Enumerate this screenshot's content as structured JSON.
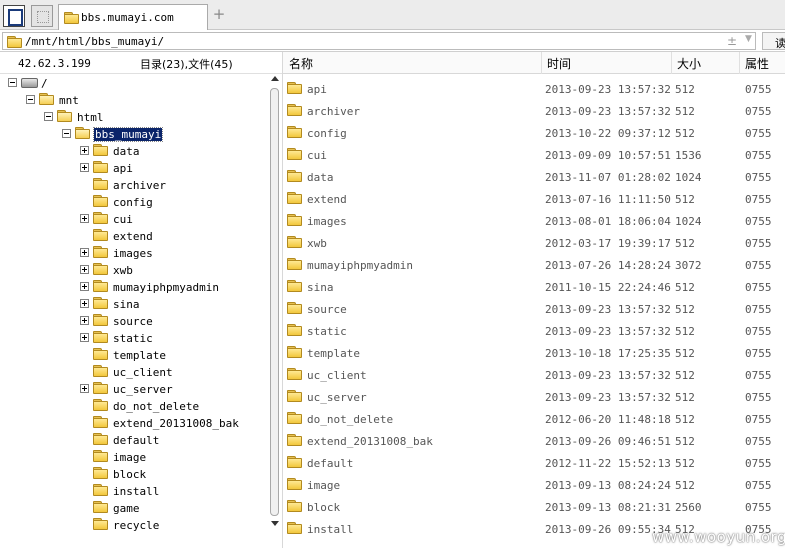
{
  "tabbar": {
    "tab_title": "bbs.mumayi.com",
    "add_label": "+"
  },
  "address": {
    "path": "/mnt/html/bbs_mumayi/",
    "plusminus": "±",
    "dropdown": "▼",
    "read_label": "读"
  },
  "info": {
    "ip": "42.62.3.199",
    "counts": "目录(23),文件(45)"
  },
  "tree": {
    "root": "/",
    "mnt": "mnt",
    "html": "html",
    "current": "bbs_mumayi",
    "children": [
      {
        "name": "data",
        "expandable": true
      },
      {
        "name": "api",
        "expandable": true
      },
      {
        "name": "archiver",
        "expandable": false
      },
      {
        "name": "config",
        "expandable": false
      },
      {
        "name": "cui",
        "expandable": true
      },
      {
        "name": "extend",
        "expandable": false
      },
      {
        "name": "images",
        "expandable": true
      },
      {
        "name": "xwb",
        "expandable": true
      },
      {
        "name": "mumayiphpmyadmin",
        "expandable": true
      },
      {
        "name": "sina",
        "expandable": true
      },
      {
        "name": "source",
        "expandable": true
      },
      {
        "name": "static",
        "expandable": true
      },
      {
        "name": "template",
        "expandable": false
      },
      {
        "name": "uc_client",
        "expandable": false
      },
      {
        "name": "uc_server",
        "expandable": true
      },
      {
        "name": "do_not_delete",
        "expandable": false
      },
      {
        "name": "extend_20131008_bak",
        "expandable": false
      },
      {
        "name": "default",
        "expandable": false
      },
      {
        "name": "image",
        "expandable": false
      },
      {
        "name": "block",
        "expandable": false
      },
      {
        "name": "install",
        "expandable": false
      },
      {
        "name": "game",
        "expandable": false
      },
      {
        "name": "recycle",
        "expandable": false
      }
    ]
  },
  "filelist": {
    "columns": {
      "name": "名称",
      "time": "时间",
      "size": "大小",
      "attr": "属性"
    },
    "rows": [
      {
        "name": "api",
        "time": "2013-09-23 13:57:32",
        "size": "512",
        "attr": "0755"
      },
      {
        "name": "archiver",
        "time": "2013-09-23 13:57:32",
        "size": "512",
        "attr": "0755"
      },
      {
        "name": "config",
        "time": "2013-10-22 09:37:12",
        "size": "512",
        "attr": "0755"
      },
      {
        "name": "cui",
        "time": "2013-09-09 10:57:51",
        "size": "1536",
        "attr": "0755"
      },
      {
        "name": "data",
        "time": "2013-11-07 01:28:02",
        "size": "1024",
        "attr": "0755"
      },
      {
        "name": "extend",
        "time": "2013-07-16 11:11:50",
        "size": "512",
        "attr": "0755"
      },
      {
        "name": "images",
        "time": "2013-08-01 18:06:04",
        "size": "1024",
        "attr": "0755"
      },
      {
        "name": "xwb",
        "time": "2012-03-17 19:39:17",
        "size": "512",
        "attr": "0755"
      },
      {
        "name": "mumayiphpmyadmin",
        "time": "2013-07-26 14:28:24",
        "size": "3072",
        "attr": "0755"
      },
      {
        "name": "sina",
        "time": "2011-10-15 22:24:46",
        "size": "512",
        "attr": "0755"
      },
      {
        "name": "source",
        "time": "2013-09-23 13:57:32",
        "size": "512",
        "attr": "0755"
      },
      {
        "name": "static",
        "time": "2013-09-23 13:57:32",
        "size": "512",
        "attr": "0755"
      },
      {
        "name": "template",
        "time": "2013-10-18 17:25:35",
        "size": "512",
        "attr": "0755"
      },
      {
        "name": "uc_client",
        "time": "2013-09-23 13:57:32",
        "size": "512",
        "attr": "0755"
      },
      {
        "name": "uc_server",
        "time": "2013-09-23 13:57:32",
        "size": "512",
        "attr": "0755"
      },
      {
        "name": "do_not_delete",
        "time": "2012-06-20 11:48:18",
        "size": "512",
        "attr": "0755"
      },
      {
        "name": "extend_20131008_bak",
        "time": "2013-09-26 09:46:51",
        "size": "512",
        "attr": "0755"
      },
      {
        "name": "default",
        "time": "2012-11-22 15:52:13",
        "size": "512",
        "attr": "0755"
      },
      {
        "name": "image",
        "time": "2013-09-13 08:24:24",
        "size": "512",
        "attr": "0755"
      },
      {
        "name": "block",
        "time": "2013-09-13 08:21:31",
        "size": "2560",
        "attr": "0755"
      },
      {
        "name": "install",
        "time": "2013-09-26 09:55:34",
        "size": "512",
        "attr": "0755"
      }
    ]
  },
  "watermark": "www.wooyun.org"
}
